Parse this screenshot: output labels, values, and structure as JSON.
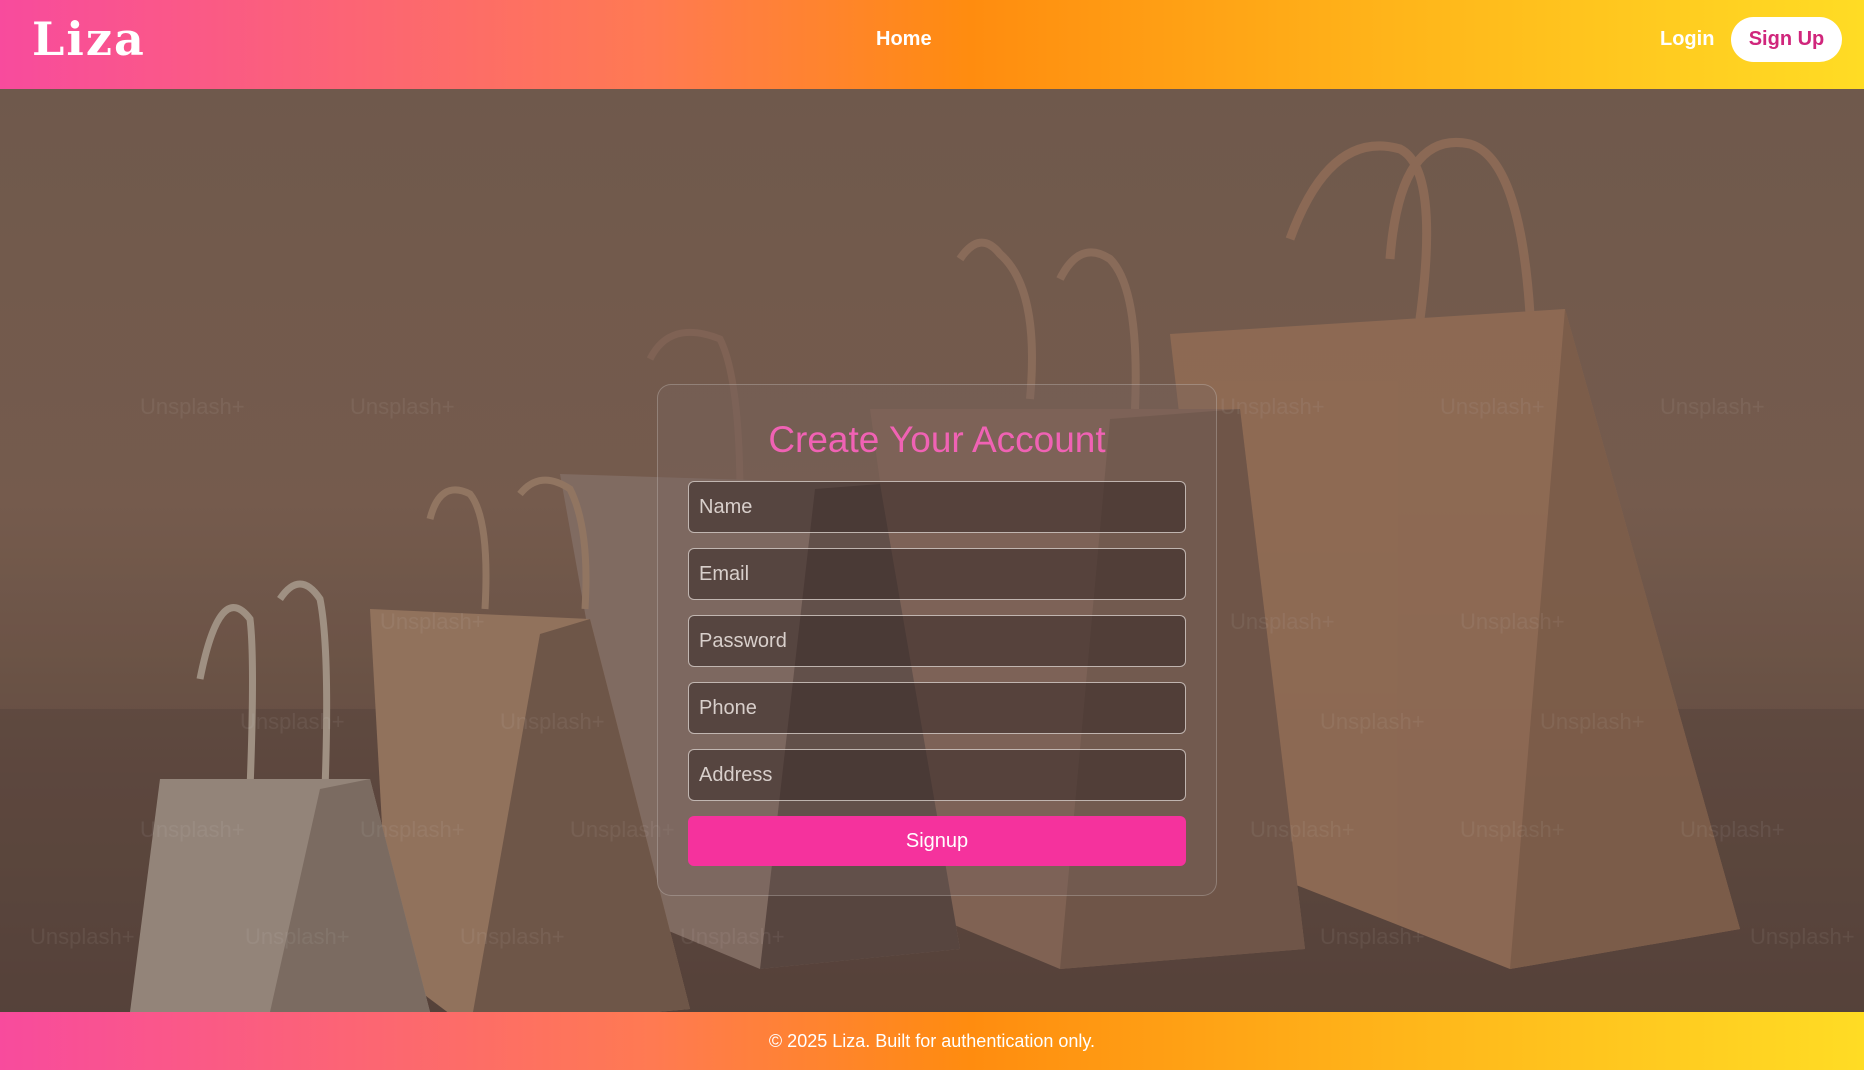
{
  "header": {
    "logo": "Liza",
    "nav_home": "Home",
    "nav_login": "Login",
    "nav_signup": "Sign Up"
  },
  "form": {
    "title": "Create Your Account",
    "fields": [
      {
        "placeholder": "Name"
      },
      {
        "placeholder": "Email"
      },
      {
        "placeholder": "Password"
      },
      {
        "placeholder": "Phone"
      },
      {
        "placeholder": "Address"
      }
    ],
    "submit_label": "Signup"
  },
  "hero": {
    "watermark": "Unsplash+"
  },
  "footer": {
    "text": "© 2025 Liza. Built for authentication only."
  },
  "colors": {
    "accent_pink": "#f5329d",
    "title_pink": "#f062b4",
    "gradient_start": "#f84b9d",
    "gradient_mid": "#ff8c0f",
    "gradient_end": "#ffdc24"
  }
}
